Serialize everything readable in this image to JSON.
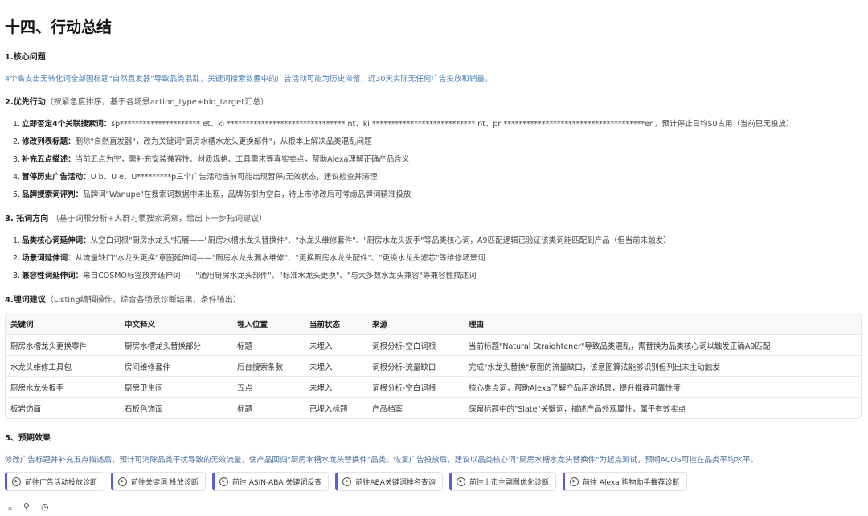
{
  "title": "十四、行动总结",
  "s1": {
    "heading": "1.核心问题",
    "text": "4个高支出无转化词全部因标题\"自然直发器\"导致品类混乱，关键词搜索数据中的广告活动可能为历史滞留，近30天实际无任何广告投放和销量。"
  },
  "s2": {
    "heading": "2.优先行动",
    "sub": "（按紧急度排序，基于各场景action_type+bid_target汇总）",
    "items": [
      {
        "num": "1.",
        "bold": "立即否定4个关联搜索词：",
        "text": "sp********************* et、ki ******************************* nt、ki *************************** nt、pr *************************************en，预计停止日均$0占用（当前已无投放）"
      },
      {
        "num": "2.",
        "bold": "修改列表标题：",
        "text": "删除\"自然直发器\"，改为关键词\"厨房水槽水龙头更换部件\"，从根本上解决品类混乱问题"
      },
      {
        "num": "3.",
        "bold": "补充五点描述：",
        "text": "当前五点为空，需补充安装兼容性、材质规格、工具需求等真实卖点，帮助Alexa理解正确产品含义"
      },
      {
        "num": "4.",
        "bold": "暂停历史广告活动：",
        "text": "U b、U e、U*********p三个广告活动当前可能出现暂停/无效状态，建议检查并清理"
      },
      {
        "num": "5.",
        "bold": "品牌搜索词评判：",
        "text": "品牌词\"Wanupe\"在搜索词数据中未出现，品牌防御为空白，待上市修改后可考虑品牌词精准投放"
      }
    ]
  },
  "s3": {
    "heading": "3. 拓词方向",
    "sub": "（基于词根分析+人群习惯搜索洞察，给出下一步拓词建议）",
    "items": [
      {
        "num": "1.",
        "bold": "品类核心词延伸词：",
        "text": "从空白词根\"厨房水龙头\"拓展——\"厨房水槽水龙头替换件\"、\"水龙头维修套件\"、\"厨房水龙头扳手\"等品类核心词，A9匹配逻辑已验证该类词能匹配到产品（但当前未触发）"
      },
      {
        "num": "2.",
        "bold": "场景词延伸词：",
        "text": "从流量缺口\"水龙头更换\"意图延伸词——\"厨房水龙头漏水维修\"、\"更换厨房水龙头配件\"、\"更换水龙头滤芯\"等维修场景词"
      },
      {
        "num": "3.",
        "bold": "兼容性词延伸词：",
        "text": "来自COSMO标签放弃延伸词——\"通用厨房水龙头部件\"、\"标准水龙头更换\"、\"与大多数水龙头兼容\"等兼容性描述词"
      }
    ]
  },
  "s4": {
    "heading": "4.埋词建议",
    "sub": "（Listing编辑操作，综合各场景诊断结果，条件输出）",
    "columns": [
      "关键词",
      "中文释义",
      "埋入位置",
      "当前状态",
      "来源",
      "理由"
    ],
    "rows": [
      [
        "厨房水槽龙头更换零件",
        "厨房水槽龙头替换部分",
        "标题",
        "未埋入",
        "词根分析-空白词根",
        "当前标题\"Natural Straightener\"导致品类混乱，需替换为品类核心词以触发正确A9匹配"
      ],
      [
        "水龙头维修工具包",
        "房间维修套件",
        "后台搜索条款",
        "未埋入",
        "词根分析-流量缺口",
        "完成\"水龙头替换\"意图的流量缺口，该意图算法能够识别但列出未主动触发"
      ],
      [
        "厨房水龙头扳手",
        "厨房卫生间",
        "五点",
        "未埋入",
        "词根分析-空白词根",
        "核心卖点词，帮助Alexa了解产品用途场景，提升推荐可靠性度"
      ],
      [
        "板岩饰面",
        "石板色饰面",
        "标题",
        "已埋入标题",
        "产品档案",
        "保留标题中的\"Slate\"关键词，描述产品外观属性，属于有效卖点"
      ]
    ]
  },
  "s5": {
    "heading": "5、预期效果",
    "text": "修改广告标题并补充五点描述后，预计可消除品类干扰导致的无效流量，使产品回归\"厨房水槽水龙头替换件\"品类。恢复广告投放后，建议以品类核心词\"厨房水槽水龙头替换件\"为起点测试，预期ACOS可控在品类平均水平。"
  },
  "buttons": [
    "前往广告活动投放诊断",
    "前往关键词 投放诊断",
    "前往 ASIN-ABA 关键词反查",
    "前往ABA关键词排名查询",
    "前往上市主副图优化诊断",
    "前往 Alexa 购物助手推荐诊断"
  ],
  "tools": {
    "download": "⤓",
    "pin": "⚲",
    "history": "◷"
  },
  "colors": {
    "accent": "#5b5bd6",
    "link_text": "#4a7bb0"
  }
}
